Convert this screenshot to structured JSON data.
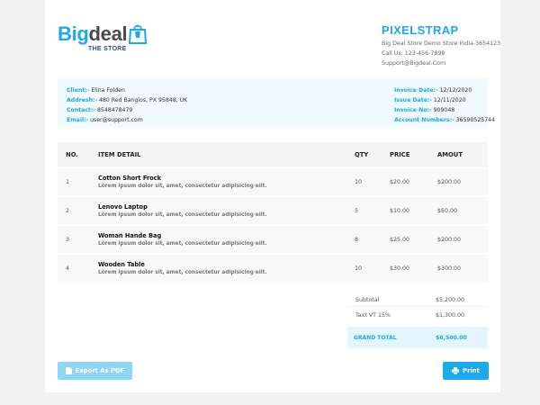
{
  "brand": {
    "logo_part1": "Big",
    "logo_part2": "deal",
    "logo_sub": "THE STORE",
    "company": "PIXELSTRAP",
    "address": "Big Deal Store Demo Store India-3654123",
    "phone": "Call Us: 123-456-7898",
    "email": "Support@Bigdeal.Com",
    "accent": "#1da9ec"
  },
  "info": {
    "left": [
      {
        "label": "Client:-",
        "value": "Elina Folden"
      },
      {
        "label": "Addresh:-",
        "value": "480 Red Banglos, PX 95848, UK"
      },
      {
        "label": "Contact:-",
        "value": "8548478479"
      },
      {
        "label": "Email:-",
        "value": "user@support.com"
      }
    ],
    "right": [
      {
        "label": "Invoice Date:-",
        "value": "12/12/2020"
      },
      {
        "label": "Issue Date:-",
        "value": "12/11/2020"
      },
      {
        "label": "Invoice No:-",
        "value": "909048"
      },
      {
        "label": "Account Numbers:-",
        "value": "36590525744"
      }
    ]
  },
  "table": {
    "headers": {
      "no": "NO.",
      "item": "ITEM DETAIL",
      "qty": "QTY",
      "price": "PRICE",
      "amount": "AMOUT"
    },
    "rows": [
      {
        "no": "1",
        "name": "Cotton Short Frock",
        "desc": "Lorem ipsum dolor sit, amet, consectetur adipisicing elit.",
        "qty": "10",
        "price": "$20.00",
        "amount": "$200.00"
      },
      {
        "no": "2",
        "name": "Lenovo Laptop",
        "desc": "Lorem ipsum dolor sit, amet, consectetur adipisicing elit.",
        "qty": "5",
        "price": "$10.00",
        "amount": "$50.00"
      },
      {
        "no": "3",
        "name": "Woman Hande Bag",
        "desc": "Lorem ipsum dolor sit, amet, consectetur adipisicing elit.",
        "qty": "8",
        "price": "$25.00",
        "amount": "$200.00"
      },
      {
        "no": "4",
        "name": "Wooden Table",
        "desc": "Lorem ipsum dolor sit, amet, consectetur adipisicing elit.",
        "qty": "10",
        "price": "$30.00",
        "amount": "$300.00"
      }
    ]
  },
  "totals": {
    "subtotal_label": "Subtotal",
    "subtotal_value": "$5,200.00",
    "tax_label": "Taxt VT 15%",
    "tax_value": "$1,300.00",
    "grand_label": "GRAND TOTAL",
    "grand_value": "$6,500.00"
  },
  "buttons": {
    "export_label": "Export As PDF",
    "export_icon": "file-icon",
    "print_label": "Print",
    "print_icon": "printer-icon"
  }
}
